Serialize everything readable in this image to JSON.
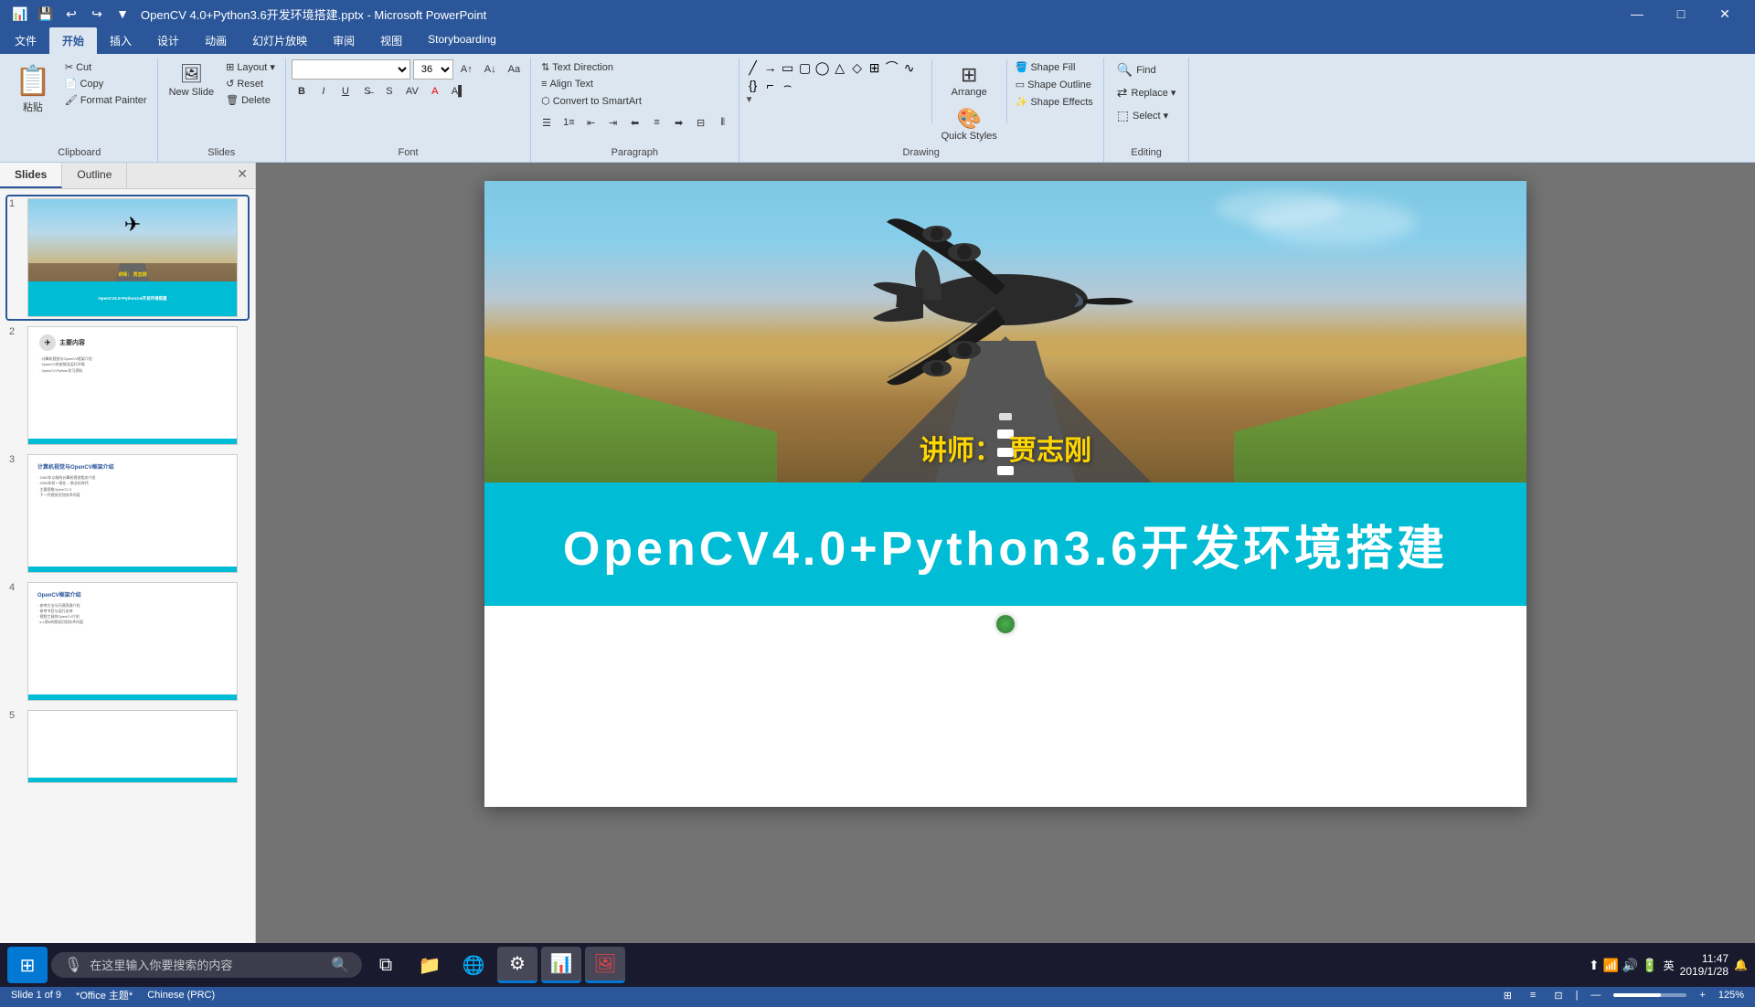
{
  "window": {
    "title": "OpenCV 4.0+Python3.6开发环境搭建.pptx - Microsoft PowerPoint",
    "controls": {
      "minimize": "—",
      "maximize": "□",
      "close": "✕"
    }
  },
  "quickaccess": {
    "save": "💾",
    "undo": "↩",
    "redo": "↪",
    "dropdown": "▼"
  },
  "ribbon": {
    "tabs": [
      "文件",
      "开始",
      "插入",
      "设计",
      "动画",
      "幻灯片放映",
      "审阅",
      "视图",
      "Storyboarding"
    ],
    "active_tab": "开始",
    "groups": {
      "clipboard": {
        "label": "Clipboard",
        "paste": "粘贴",
        "copy": "Copy",
        "cut": "Cut",
        "format_painter": "Format Painter",
        "reset": "Reset",
        "new_slide": "New Slide",
        "delete": "Delete"
      },
      "slides": {
        "label": "Slides"
      },
      "font": {
        "label": "Font",
        "font_name": "",
        "font_size": "36",
        "increase_size": "A↑",
        "decrease_size": "A↓",
        "bold": "B",
        "italic": "I",
        "underline": "U",
        "strikethrough": "S"
      },
      "paragraph": {
        "label": "Paragraph",
        "text_direction_label": "Text Direction",
        "align_text": "Align Text",
        "convert_smartart": "Convert to SmartArt"
      },
      "drawing": {
        "label": "Drawing",
        "shape_fill": "Shape Fill",
        "shape_outline": "Shape Outline",
        "shape_effects": "Shape Effects",
        "arrange": "Arrange",
        "quick_styles": "Quick Styles"
      },
      "editing": {
        "label": "Editing",
        "find": "Find",
        "replace_label": "Replace",
        "select_label": "Select",
        "find_replace": "Find Replace",
        "select": "Select"
      }
    }
  },
  "slide_panel": {
    "tabs": [
      "Slides",
      "Outline"
    ],
    "active_tab": "Slides",
    "close_icon": "✕"
  },
  "slides": [
    {
      "id": 1,
      "active": true,
      "instructor": "讲师：  贾志刚",
      "title": "OpenCV4.0+Python3.6开发环境搭建"
    },
    {
      "id": 2,
      "title": "主要内容"
    },
    {
      "id": 3,
      "title": "计算机视觉与OpenCV框架介绍"
    },
    {
      "id": 4,
      "title": "OpenCV框架介绍"
    },
    {
      "id": 5,
      "title": ""
    }
  ],
  "main_slide": {
    "instructor_text": "讲师：  贾志刚",
    "title": "OpenCV4.0+Python3.6开发环境搭建"
  },
  "status_bar": {
    "slide_info": "Slide 1 of 9",
    "theme": "*Office 主题*",
    "language": "Chinese (PRC)",
    "view_icons": [
      "⊞",
      "≡",
      "⊡"
    ],
    "zoom": "125%",
    "zoom_minus": "—",
    "zoom_plus": "+"
  },
  "taskbar": {
    "start_icon": "⊞",
    "search_placeholder": "在这里输入你要搜索的内容",
    "apps": [
      "🗂",
      "🔍",
      "📁",
      "🌐",
      "⚙",
      "📊"
    ],
    "time": "11:47",
    "date": "2019/1/28",
    "lang": "英"
  }
}
